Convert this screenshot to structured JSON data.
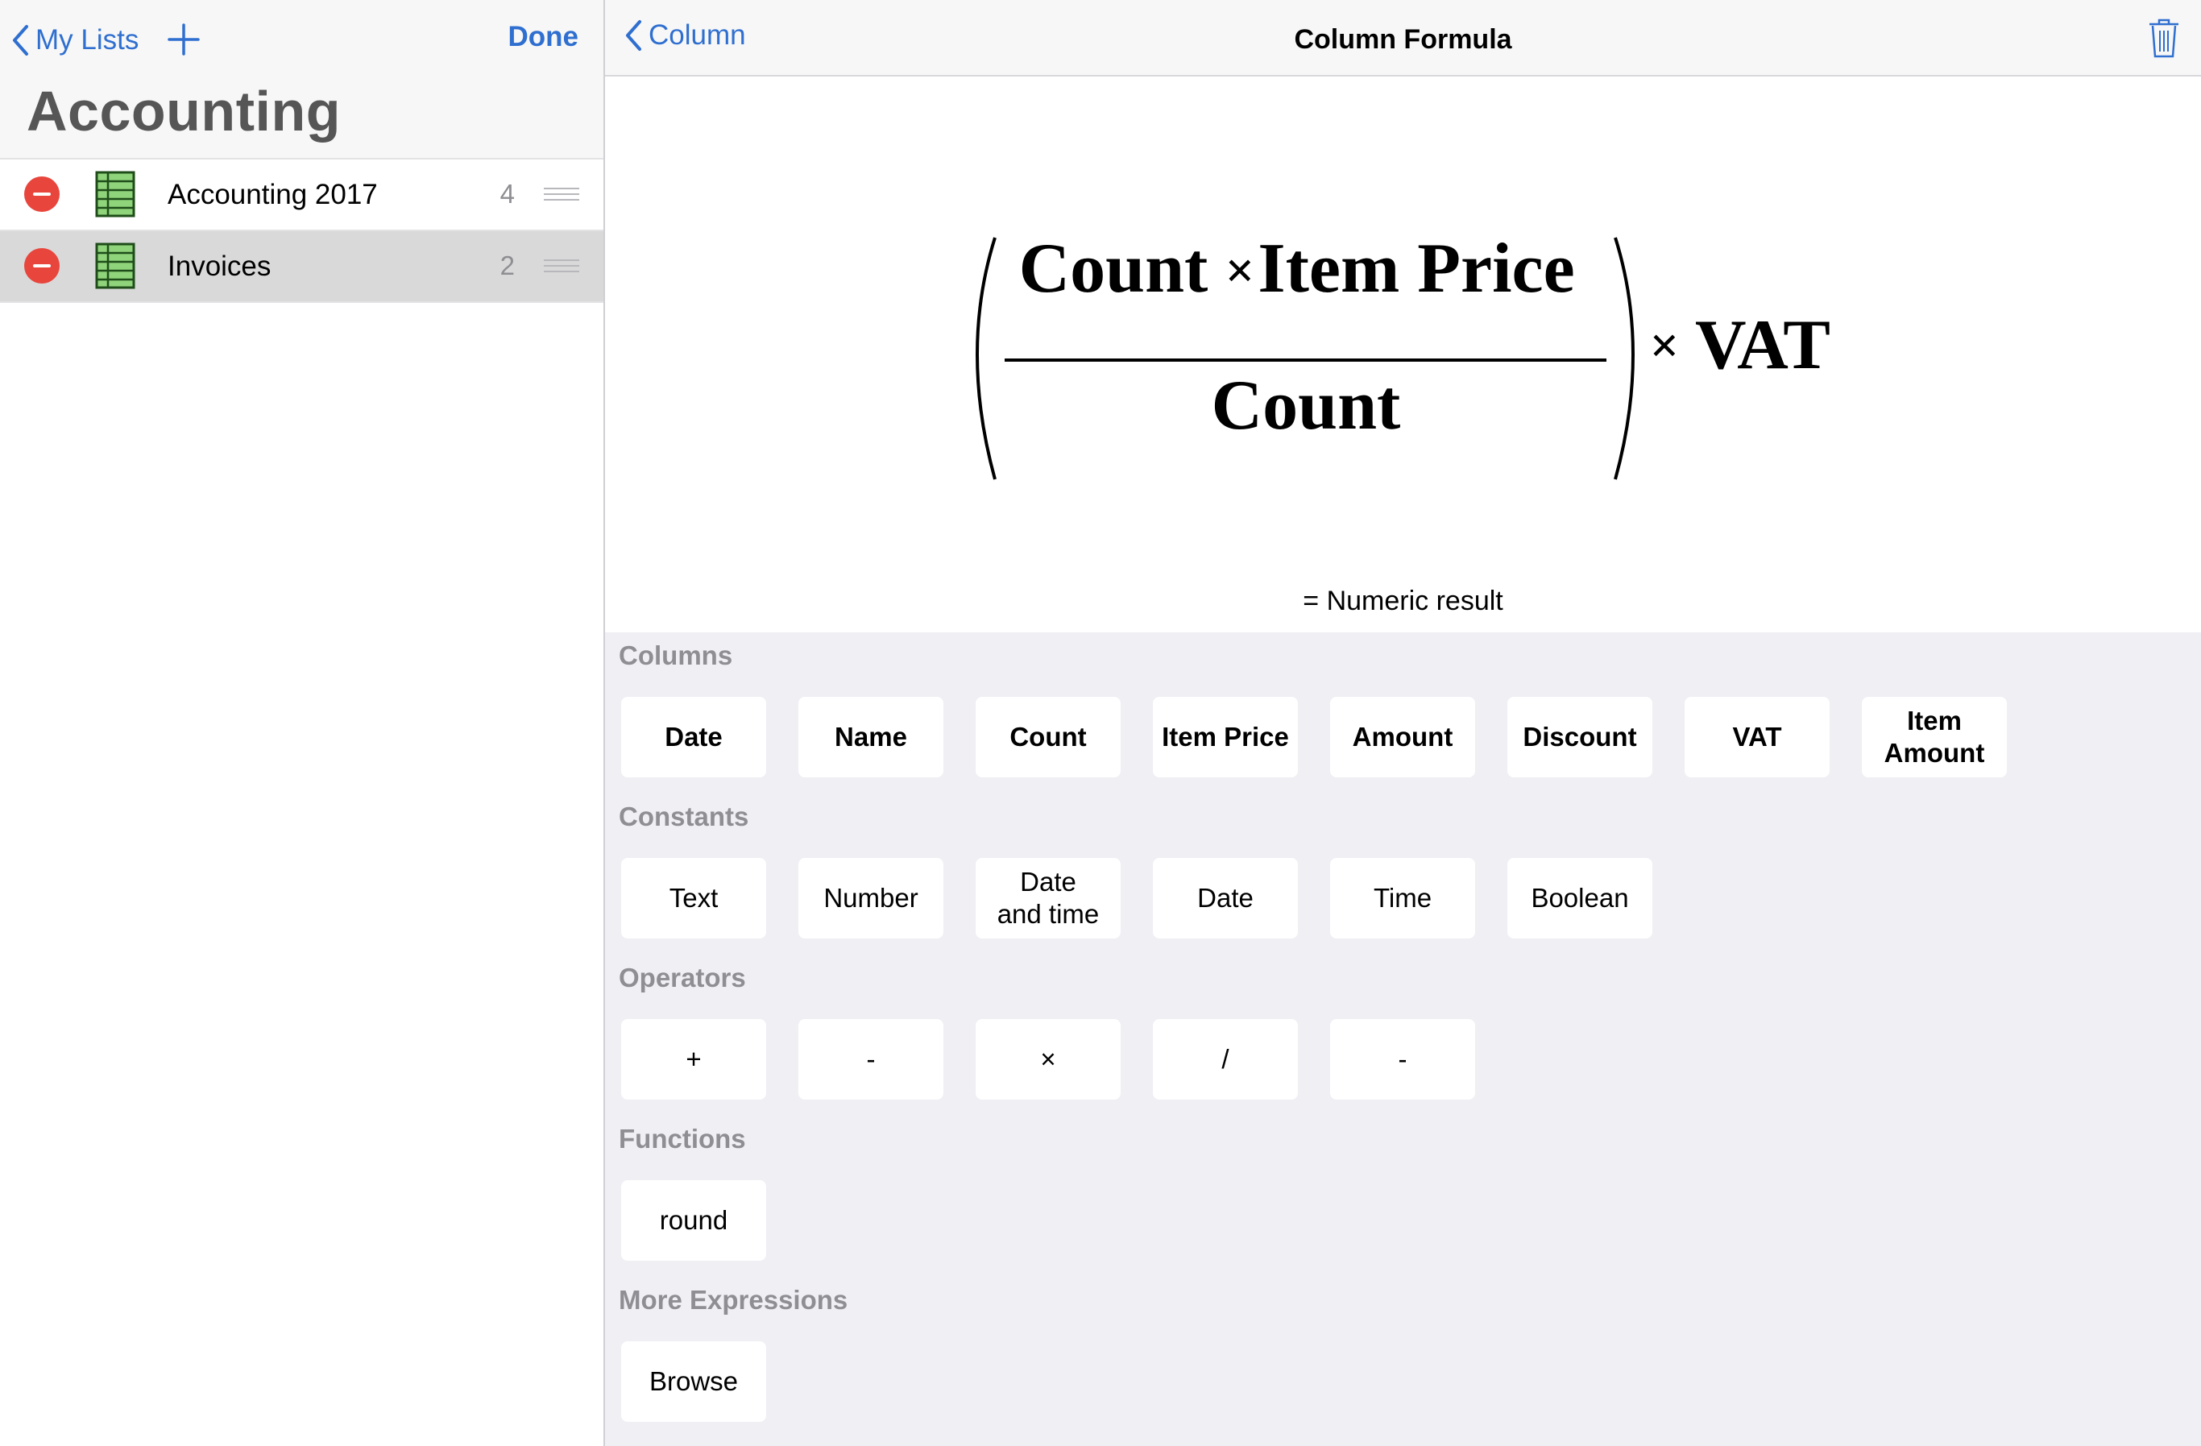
{
  "sidebar": {
    "back_label": "My Lists",
    "done_label": "Done",
    "title": "Accounting",
    "lists": [
      {
        "name": "Accounting 2017",
        "count": "4",
        "selected": false
      },
      {
        "name": "Invoices",
        "count": "2",
        "selected": true
      }
    ]
  },
  "main": {
    "back_label": "Column",
    "title": "Column Formula",
    "formula": {
      "numerator_left": "Count",
      "times": "×",
      "numerator_right": "Item Price",
      "denominator": "Count",
      "outer_times": "×",
      "outer_factor": "VAT"
    },
    "result": "= Numeric result"
  },
  "palette": {
    "columns": {
      "label": "Columns",
      "keys": [
        "Date",
        "Name",
        "Count",
        "Item Price",
        "Amount",
        "Discount",
        "VAT",
        "Item Amount"
      ]
    },
    "constants": {
      "label": "Constants",
      "keys": [
        "Text",
        "Number",
        "Date and time",
        "Date",
        "Time",
        "Boolean"
      ]
    },
    "operators": {
      "label": "Operators",
      "keys": [
        "+",
        "-",
        "×",
        "/",
        "-"
      ]
    },
    "functions": {
      "label": "Functions",
      "keys": [
        "round"
      ]
    },
    "more": {
      "label": "More Expressions",
      "keys": [
        "Browse"
      ]
    }
  },
  "colors": {
    "accent": "#2f6fd0",
    "delete": "#e8453c",
    "sheet_green": "#8fd37a",
    "palette_bg": "#efeff4"
  },
  "icons": [
    "chevron-left-icon",
    "plus-icon",
    "spreadsheet-icon",
    "minus-circle-icon",
    "reorder-icon",
    "trash-icon"
  ]
}
